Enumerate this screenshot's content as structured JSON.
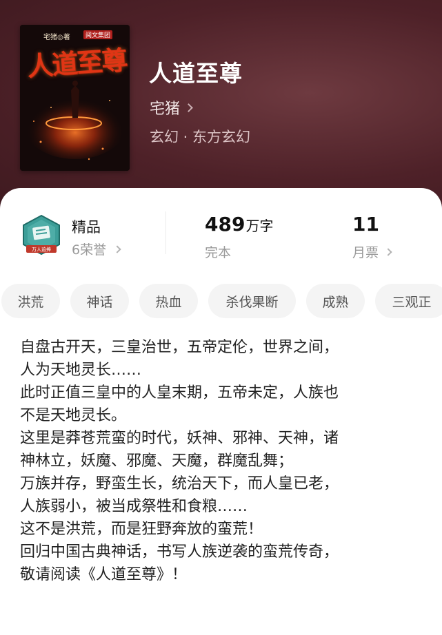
{
  "book": {
    "cover": {
      "author": "宅猪",
      "author_suffix": "◎著",
      "publisher": "阅文集团",
      "title": "人道至尊"
    },
    "title": "人道至尊",
    "author": "宅猪",
    "genre": "玄幻 · 东方玄幻"
  },
  "stats": {
    "honor": {
      "title": "精品",
      "subtitle": "6荣誉",
      "badge_text": "万人追捧"
    },
    "words": {
      "number": "489",
      "unit": "万字",
      "status": "完本"
    },
    "votes": {
      "number": "11",
      "label": "月票"
    }
  },
  "tags": [
    "洪荒",
    "神话",
    "热血",
    "杀伐果断",
    "成熟",
    "三观正"
  ],
  "description": [
    "自盘古开天，三皇治世，五帝定伦，世界之间，",
    "人为天地灵长……",
    "此时正值三皇中的人皇末期，五帝未定，人族也",
    "不是天地灵长。",
    "这里是莽苍荒蛮的时代，妖神、邪神、天神，诸",
    "神林立，妖魔、邪魔、天魔，群魔乱舞；",
    "万族并存，野蛮生长，统治天下，而人皇已老，",
    "人族弱小，被当成祭牲和食粮……",
    "这不是洪荒，而是狂野奔放的蛮荒！",
    "回归中国古典神话，书写人族逆袭的蛮荒传奇，",
    "敬请阅读《人道至尊》！"
  ],
  "colors": {
    "header_bg": "#4e2128",
    "cover_title": "#e03515",
    "badge_teal": "#2f8f8a",
    "badge_red": "#c0392b"
  }
}
